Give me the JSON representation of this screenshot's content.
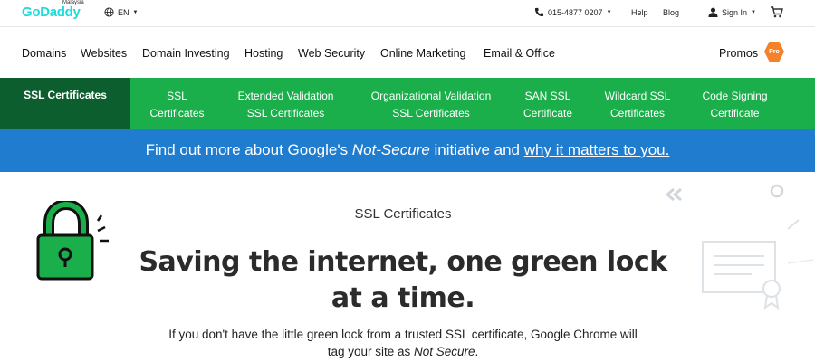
{
  "topbar": {
    "logo": "GoDaddy",
    "region": "Malaysia",
    "language": "EN",
    "phone": "015-4877 0207",
    "help": "Help",
    "blog": "Blog",
    "signin": "Sign In"
  },
  "nav": {
    "items": [
      "Domains",
      "Websites",
      "Domain Investing",
      "Hosting",
      "Web Security",
      "Online Marketing",
      "Email & Office"
    ],
    "promos": "Promos",
    "promo_badge": "Pro"
  },
  "subnav": {
    "items": [
      {
        "line1": "SSL Certificates",
        "line2": ""
      },
      {
        "line1": "SSL",
        "line2": "Certificates"
      },
      {
        "line1": "Extended Validation",
        "line2": "SSL Certificates"
      },
      {
        "line1": "Organizational Validation",
        "line2": "SSL Certificates"
      },
      {
        "line1": "SAN SSL",
        "line2": "Certificate"
      },
      {
        "line1": "Wildcard SSL",
        "line2": "Certificates"
      },
      {
        "line1": "Code Signing",
        "line2": "Certificate"
      }
    ]
  },
  "banner": {
    "pre": "Find out more about Google's ",
    "em": "Not-Secure",
    "mid": " initiative and ",
    "link": "why it matters to you."
  },
  "hero": {
    "subtitle": "SSL Certificates",
    "title_line1": "Saving the internet, one green lock",
    "title_line2": "at a time.",
    "body_line1": "If you don't have the little green lock from a trusted SSL certificate, Google Chrome will",
    "body_line2_pre": "tag your site as ",
    "body_line2_em": "Not Secure",
    "body_line2_post": "."
  },
  "colors": {
    "brand": "#1bdbdb",
    "green": "#1baf4b",
    "green_dark": "#0d5e2e",
    "blue": "#1f7ccf",
    "orange": "#f5822a"
  }
}
